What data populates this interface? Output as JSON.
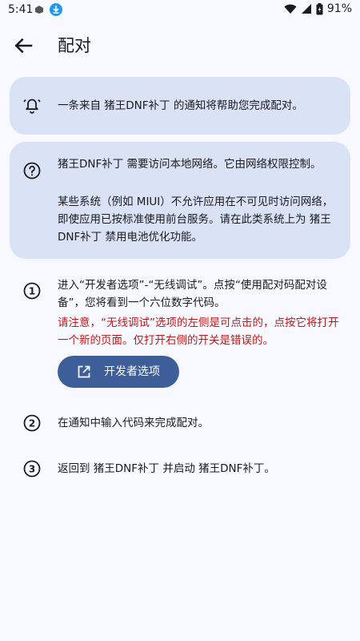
{
  "status_bar": {
    "time": "5:41",
    "battery": "91%"
  },
  "app_bar": {
    "title": "配对"
  },
  "notice_card": {
    "text": "一条来自 猪王DNF补丁 的通知将帮助您完成配对。"
  },
  "help_card": {
    "text1": "猪王DNF补丁 需要访问本地网络。它由网络权限控制。",
    "text2": "某些系统（例如 MIUI）不允许应用在不可见时访问网络，即使应用已按标准使用前台服务。请在此类系统上为 猪王DNF补丁 禁用电池优化功能。"
  },
  "steps": [
    {
      "number": "1",
      "text": "进入“开发者选项”-“无线调试”。点按“使用配对码配对设备”，您将看到一个六位数字代码。",
      "warning": "请注意，“无线调试”选项的左侧是可点击的，点按它将打开一个新的页面。仅打开右侧的开关是错误的。",
      "button_label": "开发者选项"
    },
    {
      "number": "2",
      "text": "在通知中输入代码来完成配对。"
    },
    {
      "number": "3",
      "text": "返回到 猪王DNF补丁 并启动 猪王DNF补丁。"
    }
  ],
  "colors": {
    "card": "#dae2f6",
    "button": "#3d5e99",
    "warning": "#ba1a1a",
    "background": "#f8f9ff"
  }
}
